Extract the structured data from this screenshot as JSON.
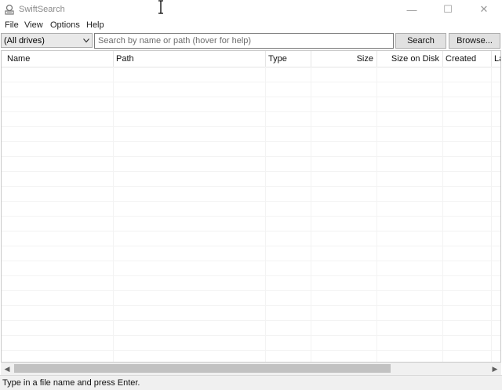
{
  "window": {
    "title": "SwiftSearch",
    "minimize_glyph": "—",
    "maximize_glyph": "☐",
    "close_glyph": "✕"
  },
  "menu": [
    "File",
    "View",
    "Options",
    "Help"
  ],
  "toolbar": {
    "drive_selected": "(All drives)",
    "search_placeholder": "Search by name or path (hover for help)",
    "search_value": "",
    "search_label": "Search",
    "browse_label": "Browse..."
  },
  "columns": [
    "Name",
    "Path",
    "Type",
    "Size",
    "Size on Disk",
    "Created",
    "La"
  ],
  "rows": [],
  "status": {
    "text": "Type in a file name and press Enter."
  },
  "colors": {
    "button_bg": "#e1e1e1",
    "border": "#adadad",
    "scroll_thumb": "#c2c2c2"
  }
}
